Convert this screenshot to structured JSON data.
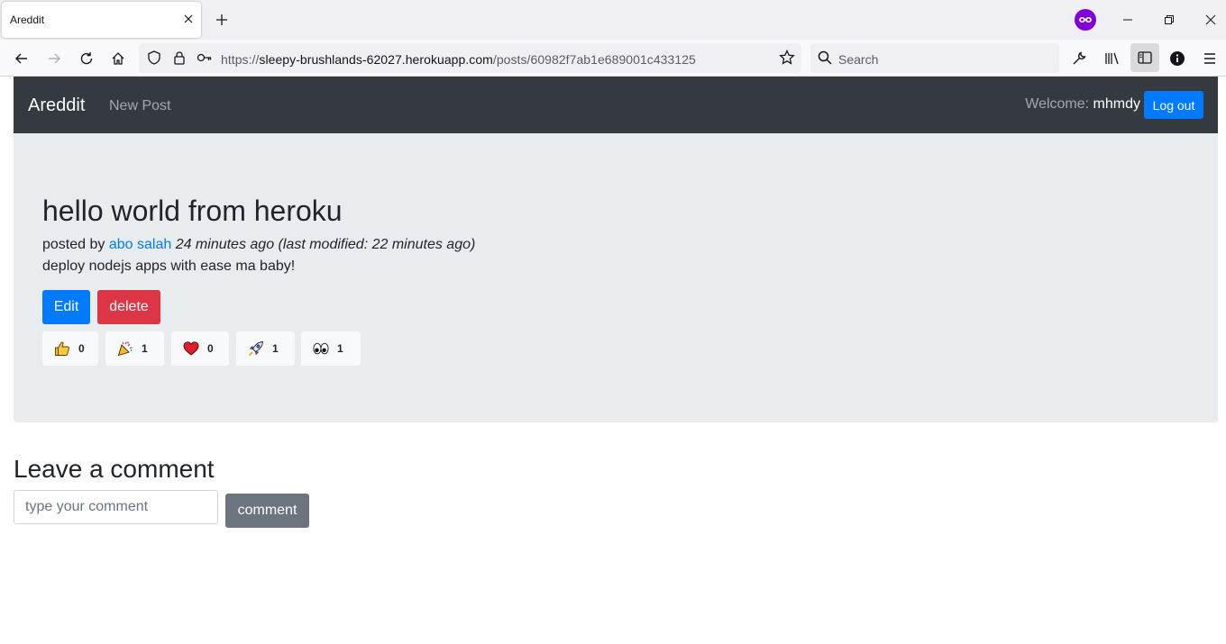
{
  "browser": {
    "tab_title": "Areddit",
    "url_base": "https://",
    "url_host": "sleepy-brushlands-62027.herokuapp.com",
    "url_path": "/posts/60982f7ab1e689001c433125",
    "search_placeholder": "Search"
  },
  "nav": {
    "brand": "Areddit",
    "new_post": "New Post",
    "welcome_label": "Welcome:",
    "username": "mhmdy",
    "logout": "Log out"
  },
  "post": {
    "title": "hello world from heroku",
    "posted_by": "posted by",
    "author": "abo salah",
    "time": "24 minutes ago (last modified: 22 minutes ago)",
    "body": "deploy nodejs apps with ease ma baby!",
    "edit_label": "Edit",
    "delete_label": "delete",
    "reactions": [
      {
        "icon": "thumbs-up-icon",
        "count": "0"
      },
      {
        "icon": "party-popper-icon",
        "count": "1"
      },
      {
        "icon": "heart-icon",
        "count": "0"
      },
      {
        "icon": "rocket-icon",
        "count": "1"
      },
      {
        "icon": "eyes-icon",
        "count": "1"
      }
    ]
  },
  "comments": {
    "heading": "Leave a comment",
    "input_placeholder": "type your comment",
    "submit_label": "comment"
  },
  "colors": {
    "navbar_bg": "#343a40",
    "primary": "#007bff",
    "danger": "#dc3545",
    "secondary": "#6c757d",
    "jumbotron_bg": "#e9ecef"
  }
}
